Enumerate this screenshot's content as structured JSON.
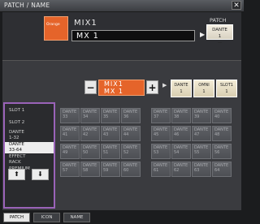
{
  "window": {
    "title": "PATCH / NAME",
    "close_glyph": "✕"
  },
  "channel": {
    "color_label": "Orange",
    "display_name": "MIX1",
    "name_value": "MX 1"
  },
  "patch": {
    "label": "PATCH",
    "button_line1": "DANTE",
    "button_line2": "1",
    "button_line3": "—"
  },
  "selector": {
    "minus": "−",
    "plus": "+",
    "line1": "MIX1",
    "line2": "MX 1"
  },
  "ports": [
    {
      "line1": "DANTE",
      "line2": "1"
    },
    {
      "line1": "OMNI",
      "line2": "1"
    },
    {
      "line1": "SLOT1",
      "line2": "1"
    }
  ],
  "source_list": [
    {
      "label": "SLOT 1"
    },
    {
      "label": "SLOT 2"
    },
    {
      "label": "DANTE\n1-32"
    },
    {
      "label": "DANTE\n33-64",
      "selected": true
    },
    {
      "label": "EFFECT\nRACK"
    },
    {
      "label": "PREMIUM\nRACK"
    }
  ],
  "nav": {
    "up": "⬆",
    "down": "⬇"
  },
  "grid": {
    "prefix": "DANTE",
    "rows": [
      [
        33,
        34,
        35,
        36,
        37,
        38,
        39,
        40
      ],
      [
        41,
        42,
        43,
        44,
        45,
        46,
        47,
        48
      ],
      [
        49,
        50,
        51,
        52,
        53,
        54,
        55,
        56
      ],
      [
        57,
        58,
        59,
        60,
        61,
        62,
        63,
        64
      ]
    ]
  },
  "tabs": [
    {
      "label": "PATCH",
      "active": true
    },
    {
      "label": "ICON"
    },
    {
      "label": "NAME"
    }
  ]
}
